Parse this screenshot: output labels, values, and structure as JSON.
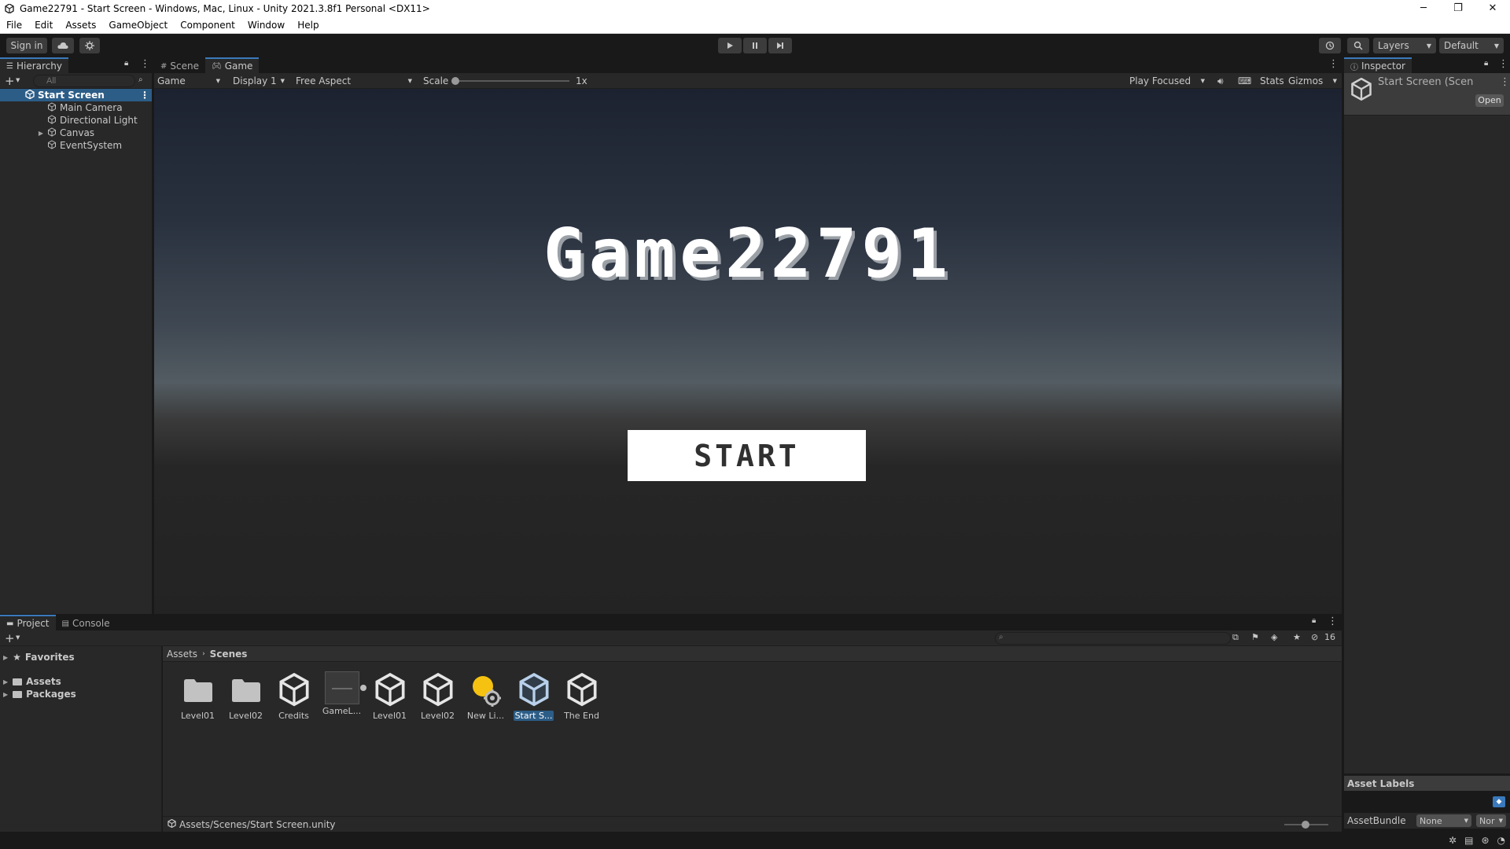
{
  "window": {
    "title": "Game22791 - Start Screen - Windows, Mac, Linux - Unity 2021.3.8f1 Personal <DX11>",
    "minimize": "─",
    "maximize": "❐",
    "close": "✕"
  },
  "menu": [
    "File",
    "Edit",
    "Assets",
    "GameObject",
    "Component",
    "Window",
    "Help"
  ],
  "toolbar": {
    "sign_in": "Sign in",
    "layers": "Layers",
    "layout": "Default"
  },
  "hierarchy": {
    "tab": "Hierarchy",
    "search_placeholder": "All",
    "scene": "Start Screen",
    "items": [
      "Main Camera",
      "Directional Light",
      "Canvas",
      "EventSystem"
    ]
  },
  "game_view": {
    "tabs": [
      "Scene",
      "Game"
    ],
    "mode": "Game",
    "display": "Display 1",
    "aspect": "Free Aspect",
    "scale_label": "Scale",
    "scale_value": "1x",
    "play_mode": "Play Focused",
    "stats": "Stats",
    "gizmos": "Gizmos",
    "game_title": "Game22791",
    "start_button": "START"
  },
  "inspector": {
    "tab": "Inspector",
    "title": "Start Screen (Scen",
    "open_button": "Open",
    "asset_labels": "Asset Labels",
    "assetbundle_label": "AssetBundle",
    "assetbundle_value": "None",
    "assetbundle_variant": "Nor"
  },
  "project": {
    "tabs": [
      "Project",
      "Console"
    ],
    "visible_count": "16",
    "favorites": "Favorites",
    "assets": "Assets",
    "packages": "Packages",
    "breadcrumb": [
      "Assets",
      "Scenes"
    ],
    "items": [
      {
        "label": "Level01",
        "icon": "folder-icon"
      },
      {
        "label": "Level02",
        "icon": "folder-icon"
      },
      {
        "label": "Credits",
        "icon": "unity-scene-icon"
      },
      {
        "label": "GameL...",
        "icon": "lighting-settings-icon"
      },
      {
        "label": "Level01",
        "icon": "unity-scene-icon"
      },
      {
        "label": "Level02",
        "icon": "unity-scene-icon"
      },
      {
        "label": "New Li...",
        "icon": "lighting-asset-icon"
      },
      {
        "label": "Start S...",
        "icon": "unity-scene-icon",
        "selected": true
      },
      {
        "label": "The End",
        "icon": "unity-scene-icon"
      }
    ],
    "path": "Assets/Scenes/Start Screen.unity"
  },
  "colors": {
    "selection": "#2c5d87",
    "accent_tab": "#3a79bb",
    "panel": "#282828",
    "background": "#191919"
  }
}
